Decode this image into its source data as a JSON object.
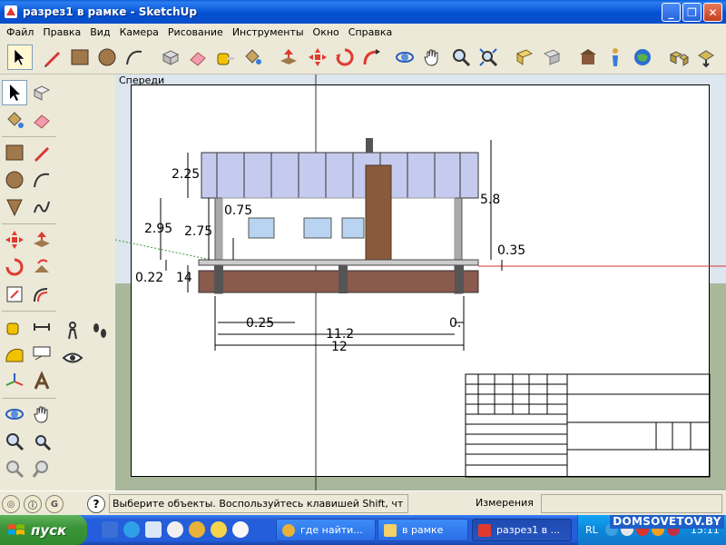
{
  "window": {
    "title": "разрез1 в рамке - SketchUp",
    "minimize": "_",
    "maximize": "❐",
    "close": "✕"
  },
  "menu": [
    "Файл",
    "Правка",
    "Вид",
    "Камера",
    "Рисование",
    "Инструменты",
    "Окно",
    "Справка"
  ],
  "viewport": {
    "view_name": "Спереди"
  },
  "drawing": {
    "dimensions": {
      "roof_height": "2.25",
      "wall_height_left": "2.95",
      "wall_height_inner": "2.75",
      "window_offset": "0.75",
      "total_height": "5.8",
      "foundation_right": "0.35",
      "plinth_left": "0.22",
      "plinth_small": "14",
      "offset_bottom_left": "0.25",
      "offset_bottom_right": "0.",
      "inner_width": "11.2",
      "total_width": "12"
    }
  },
  "status": {
    "hint": "Выберите объекты. Воспользуйтесь клавишей Shift, чт",
    "measurements_label": "Измерения",
    "measurements_value": ""
  },
  "taskbar": {
    "start": "пуск",
    "tasks": [
      "где найти...",
      "в рамке",
      "разрез1 в ..."
    ],
    "lang": "RL",
    "clock": "15:11"
  },
  "watermark": "DOMSOVETOV.BY",
  "colors": {
    "titlebar": "#0451d4",
    "roof": "#c5cbee",
    "brick": "#8a5a3c",
    "ground": "#a9b79b",
    "sky": "#dde6ee"
  }
}
